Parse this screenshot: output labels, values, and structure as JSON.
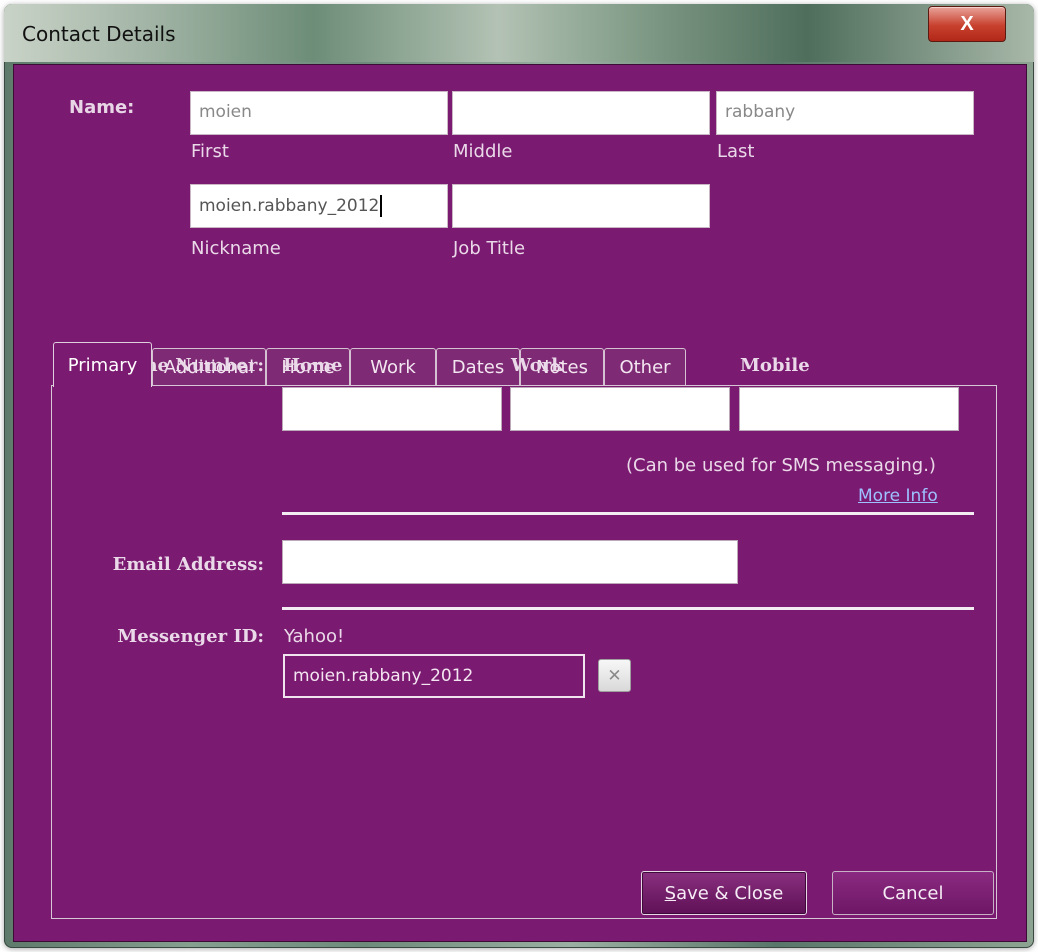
{
  "window": {
    "title": "Contact Details",
    "close_label": "X"
  },
  "name": {
    "label": "Name:",
    "first_value": "moien",
    "middle_value": "",
    "last_value": "rabbany",
    "first_caption": "First",
    "middle_caption": "Middle",
    "last_caption": "Last",
    "nickname_value": "moien.rabbany_2012",
    "job_title_value": "",
    "nickname_caption": "Nickname",
    "job_title_caption": "Job Title"
  },
  "tabs": [
    {
      "label": "Primary",
      "active": true
    },
    {
      "label": "Additional",
      "active": false
    },
    {
      "label": "Home",
      "active": false
    },
    {
      "label": "Work",
      "active": false
    },
    {
      "label": "Dates",
      "active": false
    },
    {
      "label": "Notes",
      "active": false
    },
    {
      "label": "Other",
      "active": false
    }
  ],
  "primary": {
    "phone_label": "Phone Number:",
    "phone_columns": [
      "Home",
      "Work",
      "Mobile"
    ],
    "phone_values": [
      "",
      "",
      ""
    ],
    "sms_note": "(Can be used for SMS messaging.)",
    "more_info_link": "More Info",
    "email_label": "Email Address:",
    "email_value": "",
    "messenger_label": "Messenger ID:",
    "messenger_service": "Yahoo!",
    "messenger_value": "moien.rabbany_2012",
    "remove_icon": "close-icon"
  },
  "buttons": {
    "save_mnemonic": "S",
    "save_rest": "ave & Close",
    "cancel": "Cancel"
  },
  "colors": {
    "panel_background": "#7b1a71",
    "link": "#9ec2ff",
    "close_button": "#c8402e"
  }
}
